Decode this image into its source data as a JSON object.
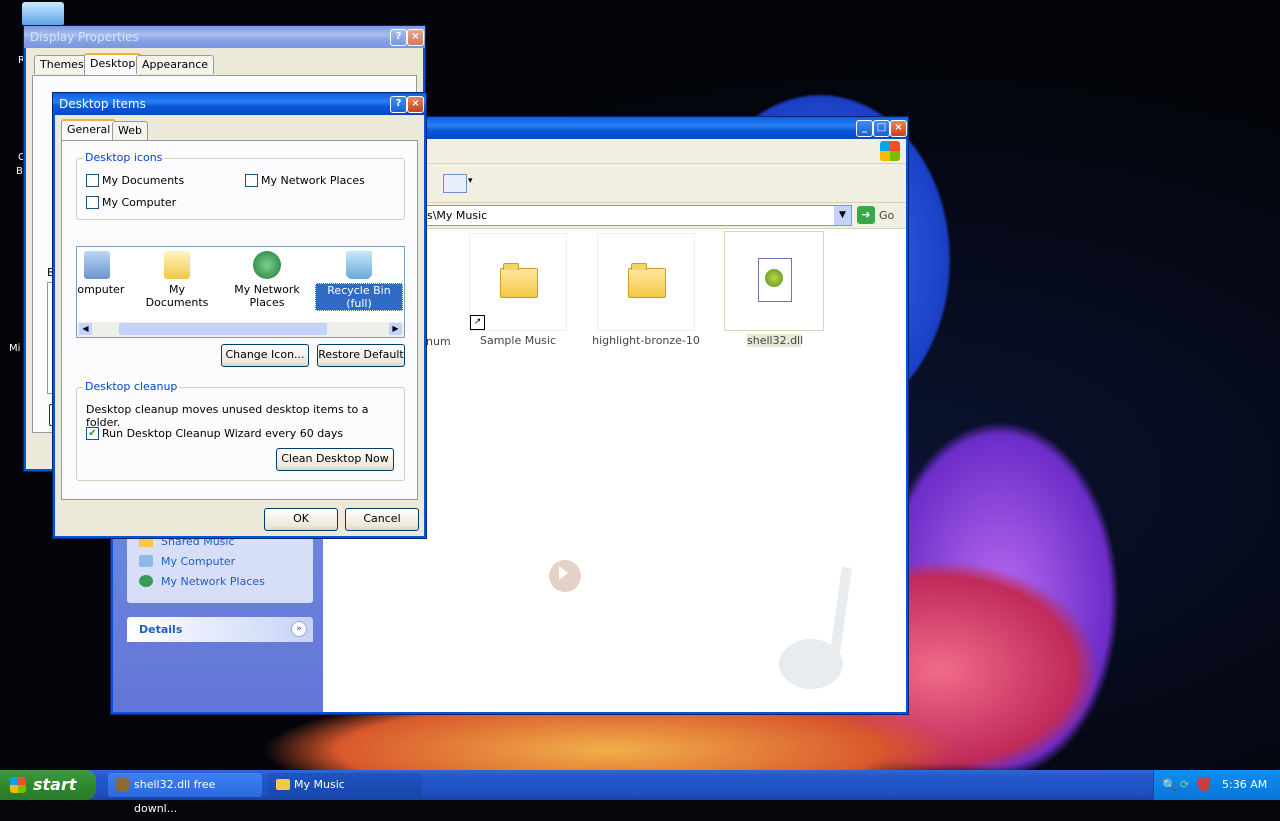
{
  "display_properties": {
    "title": "Display Properties",
    "help": "?",
    "close": "x",
    "tabs": [
      "Themes",
      "Desktop",
      "Appearance"
    ],
    "left_edge_letters": [
      "B",
      "",
      ""
    ]
  },
  "desktop_items": {
    "title": "Desktop Items",
    "help": "?",
    "close": "x",
    "tabs": [
      "General",
      "Web"
    ],
    "desktop_icons_group": "Desktop icons",
    "checkboxes": [
      {
        "label": "My Documents",
        "checked": false
      },
      {
        "label": "My Network Places",
        "checked": false
      },
      {
        "label": "My Computer",
        "checked": false
      }
    ],
    "icons": [
      "Computer",
      "My Documents",
      "My Network Places",
      "Recycle Bin (full)"
    ],
    "change_icon": "Change Icon...",
    "restore_default": "Restore Default",
    "cleanup_group": "Desktop cleanup",
    "cleanup_text": "Desktop cleanup moves unused desktop items to a folder.",
    "cleanup_checkbox": "Run Desktop Cleanup Wizard every 60 days",
    "cleanup_checked": true,
    "clean_now": "Clean Desktop Now",
    "ok": "OK",
    "cancel": "Cancel"
  },
  "explorer": {
    "address": "s\\My Music",
    "go": "Go",
    "files": [
      {
        "label": "num"
      },
      {
        "label": "Sample Music"
      },
      {
        "label": "highlight-bronze-10"
      },
      {
        "label": "shell32.dll"
      }
    ],
    "other_places": [
      "Shared Music",
      "My Computer",
      "My Network Places"
    ],
    "details": "Details"
  },
  "desktop": {
    "left_labels": [
      "R",
      "C",
      "B",
      "Mi"
    ]
  },
  "taskbar": {
    "start": "start",
    "tasks": [
      "shell32.dll free downl...",
      "My Music"
    ],
    "clock": "5:36 AM"
  }
}
